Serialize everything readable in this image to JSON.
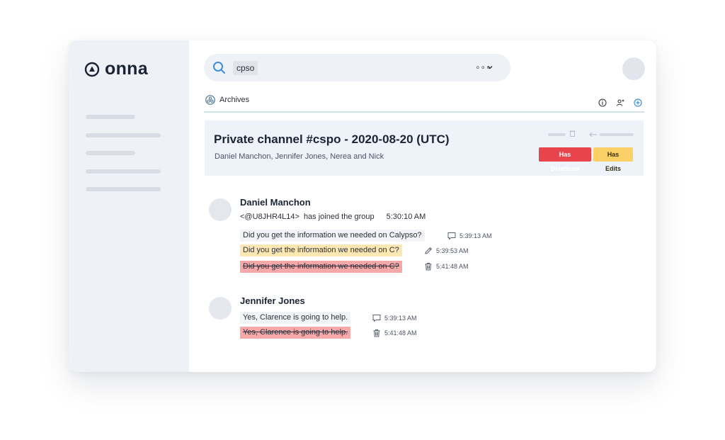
{
  "app": {
    "logo_text": "onna"
  },
  "search": {
    "query": "cpso",
    "more_label": "∘∘∘"
  },
  "section": {
    "label": "Archives"
  },
  "channel": {
    "title": "Private channel #cspo - 2020-08-20 (UTC)",
    "members": "Daniel Manchon, Jennifer Jones, Nerea and Nick",
    "badges": {
      "deletions": "Has Deletions",
      "edits": "Has Edits"
    }
  },
  "threads": [
    {
      "author": "Daniel Manchon",
      "join": {
        "user": "<@U8JHR4L14>",
        "text": "has joined the group",
        "time": "5:30:10 AM"
      },
      "lines": [
        {
          "text": "Did you get the information we needed on Calypso?",
          "status": "normal",
          "icon": "comment-icon",
          "time": "5:39:13 AM"
        },
        {
          "text": "Did you get the information we needed on C?",
          "status": "edited",
          "icon": "pencil-icon",
          "time": "5:39:53 AM"
        },
        {
          "text": "Did you get the information we needed on C?",
          "status": "deleted",
          "icon": "trash-icon",
          "time": "5:41:48 AM"
        }
      ]
    },
    {
      "author": "Jennifer Jones",
      "lines": [
        {
          "text": "Yes, Clarence is going to help.",
          "status": "normal",
          "icon": "comment-icon",
          "time": "5:39:13 AM"
        },
        {
          "text": "Yes, Clarence is going to help.",
          "status": "deleted",
          "icon": "trash-icon",
          "time": "5:41:48 AM"
        }
      ]
    }
  ],
  "colors": {
    "accent": "#3d8fd9",
    "deleted_bg": "#f7a9aa",
    "edited_bg": "#fde7b2",
    "deletions_badge": "#e9434b",
    "edits_badge": "#fbd167",
    "sidebar_bg": "#eef2f7"
  }
}
